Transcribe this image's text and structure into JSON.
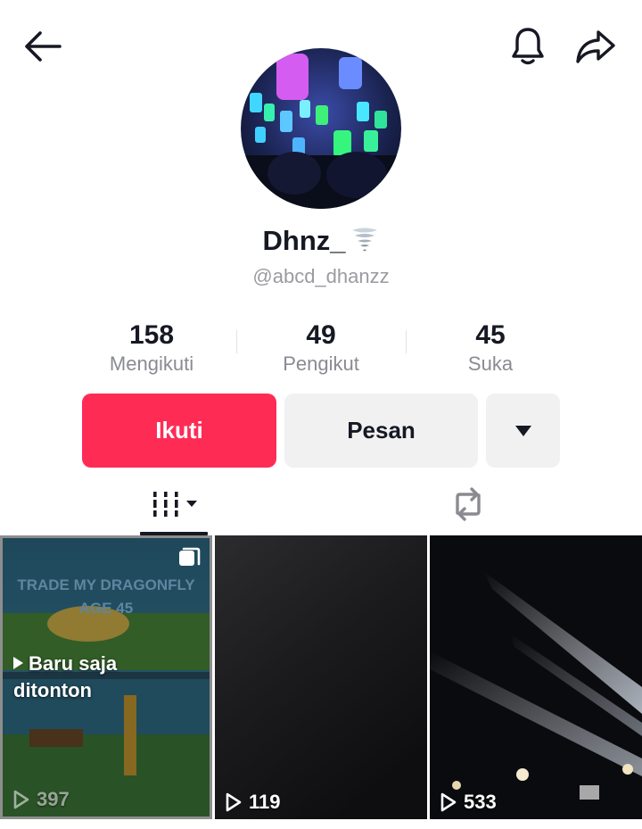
{
  "header": {
    "back_icon": "arrow-left-icon",
    "bell_icon": "bell-icon",
    "share_icon": "share-arrow-icon"
  },
  "profile": {
    "display_name": "Dhnz_",
    "name_emoji": "tornado-emoji",
    "username": "@abcd_dhanzz"
  },
  "stats": [
    {
      "value": "158",
      "label": "Mengikuti"
    },
    {
      "value": "49",
      "label": "Pengikut"
    },
    {
      "value": "45",
      "label": "Suka"
    }
  ],
  "actions": {
    "follow_label": "Ikuti",
    "message_label": "Pesan",
    "more_icon": "triangle-down-icon"
  },
  "tabs": {
    "videos_icon": "grid-bars-icon",
    "reposts_icon": "repost-icon"
  },
  "videos": [
    {
      "views": "397",
      "overlay_line1": "Baru saja",
      "overlay_line2": "ditonton",
      "thumb_text_1": "TRADE MY DRAGONFLY",
      "thumb_text_2": "AGE 45"
    },
    {
      "views": "119"
    },
    {
      "views": "533"
    }
  ],
  "colors": {
    "accent": "#fe2c55",
    "secondary_button": "#f1f1f2",
    "text_primary": "#161823",
    "text_secondary": "#8a8b91"
  }
}
